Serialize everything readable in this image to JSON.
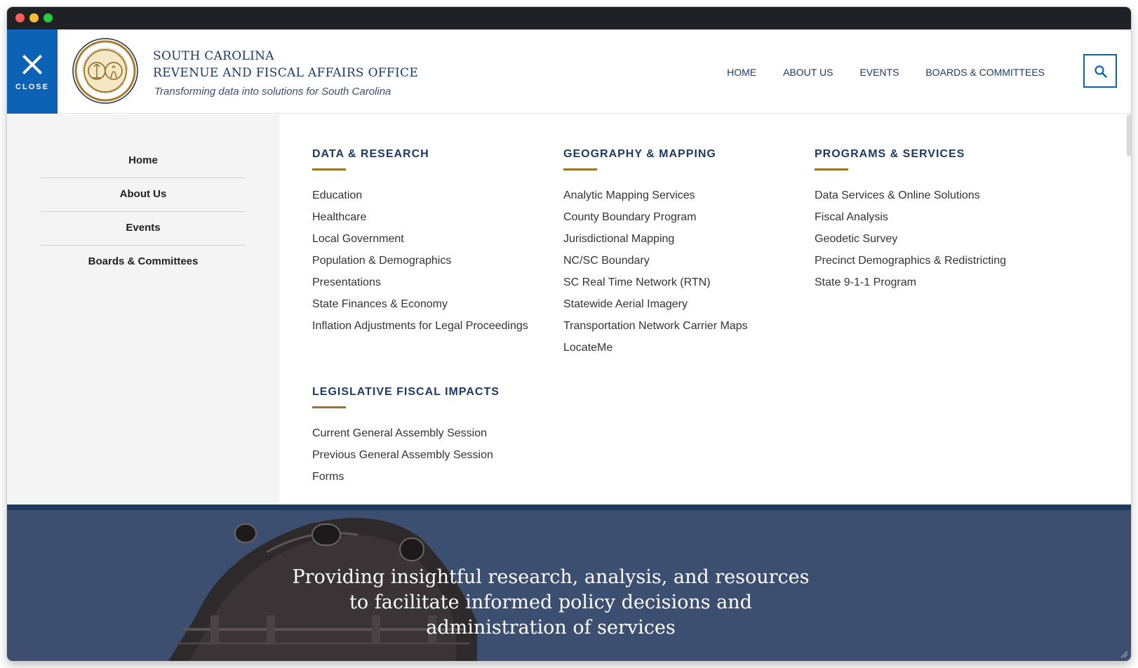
{
  "window_controls": {
    "close_color": "#ff5f57",
    "minimize_color": "#febc2e",
    "maximize_color": "#28c840"
  },
  "header": {
    "close_label": "CLOSE",
    "org_line1": "SOUTH CAROLINA",
    "org_line2": "REVENUE AND FISCAL AFFAIRS OFFICE",
    "tagline": "Transforming data into solutions for South Carolina",
    "seal_icon": "state-seal-icon",
    "nav": [
      "HOME",
      "ABOUT US",
      "EVENTS",
      "BOARDS & COMMITTEES"
    ],
    "search_icon": "search-icon"
  },
  "sidebar": {
    "items": [
      "Home",
      "About Us",
      "Events",
      "Boards & Committees"
    ]
  },
  "menu": {
    "data_research": {
      "heading": "DATA & RESEARCH",
      "links": [
        "Education",
        "Healthcare",
        "Local Government",
        "Population & Demographics",
        "Presentations",
        "State Finances & Economy",
        "Inflation Adjustments for Legal Proceedings"
      ]
    },
    "geography_mapping": {
      "heading": "GEOGRAPHY & MAPPING",
      "links": [
        "Analytic Mapping Services",
        "County Boundary Program",
        "Jurisdictional Mapping",
        "NC/SC Boundary",
        "SC Real Time Network (RTN)",
        "Statewide Aerial Imagery",
        "Transportation Network Carrier Maps",
        "LocateMe"
      ]
    },
    "programs_services": {
      "heading": "PROGRAMS & SERVICES",
      "links": [
        "Data Services & Online Solutions",
        "Fiscal Analysis",
        "Geodetic Survey",
        "Precinct Demographics & Redistricting",
        "State 9-1-1 Program"
      ]
    },
    "legislative": {
      "heading": "LEGISLATIVE FISCAL IMPACTS",
      "links": [
        "Current General Assembly Session",
        "Previous General Assembly Session",
        "Forms"
      ]
    }
  },
  "hero": {
    "line1": "Providing insightful research, analysis, and resources",
    "line2": "to facilitate informed policy decisions and",
    "line3": "administration of services"
  },
  "colors": {
    "primary_blue": "#0c62b4",
    "navy_text": "#1b3a64",
    "gold_accent": "#9c7325",
    "hero_bg": "#3c4f70"
  }
}
